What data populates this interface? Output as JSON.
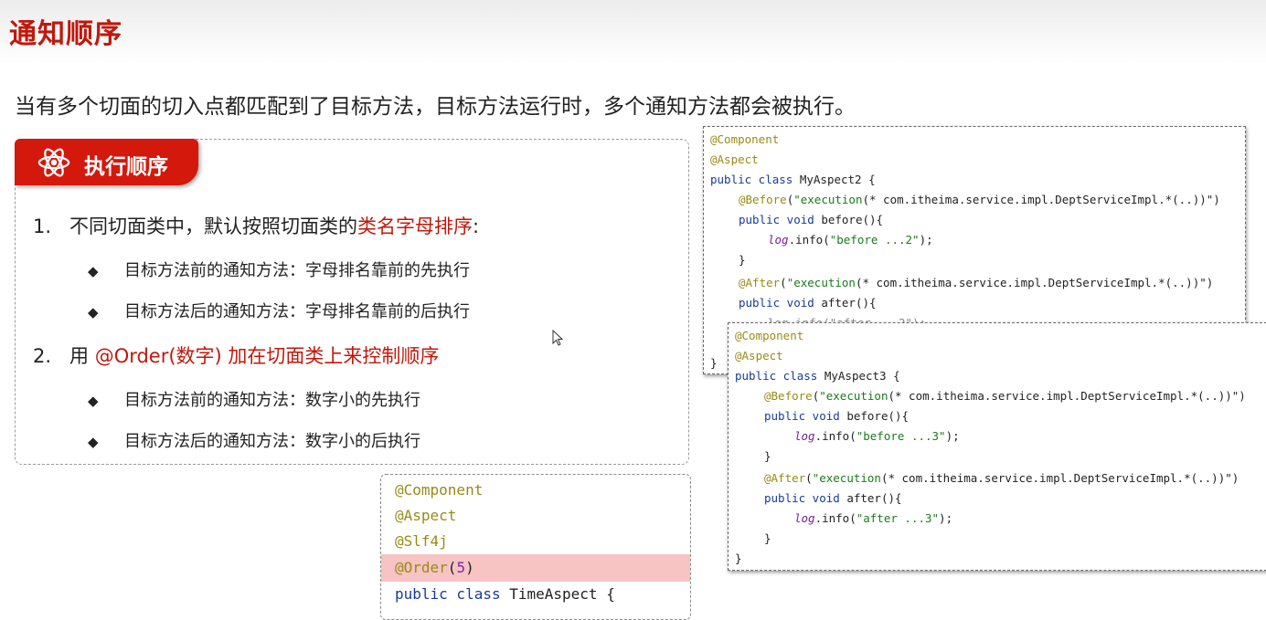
{
  "page": {
    "title": "通知顺序",
    "subtitle": "当有多个切面的切入点都匹配到了目标方法，目标方法运行时，多个通知方法都会被执行。"
  },
  "box": {
    "tag": {
      "icon": "atom-icon",
      "label": "执行顺序"
    },
    "item1": {
      "num": "1.",
      "prefix": "不同切面类中，默认按照切面类的",
      "highlight": "类名字母排序",
      "suffix": ":"
    },
    "item1_bullets": [
      "目标方法前的通知方法：字母排名靠前的先执行",
      "目标方法后的通知方法：字母排名靠前的后执行"
    ],
    "item2": {
      "num": "2.",
      "prefix": "用 ",
      "highlight": "@Order(数字) 加在切面类上来控制顺序"
    },
    "item2_bullets": [
      "目标方法前的通知方法：数字小的先执行",
      "目标方法后的通知方法：数字小的后执行"
    ],
    "bullet_char": "◆"
  },
  "code1": {
    "a1": "@Component",
    "a2": "@Aspect",
    "class_kw": "public class ",
    "class_name": "MyAspect2 {",
    "before_ann": "@Before",
    "before_open": "(",
    "before_str": "\"execution",
    "before_rest": "(* com.itheima.service.impl.DeptServiceImpl.*(..))\")",
    "before_sig_kw": "public void ",
    "before_sig": "before(){",
    "log1_a": "log",
    "log1_b": ".info(",
    "log1_str": "\"before ...2\"",
    "log1_c": ");",
    "close1": "}",
    "after_ann": "@After",
    "after_open": "(",
    "after_str": "\"execution",
    "after_rest": "(* com.itheima.service.impl.DeptServiceImpl.*(..))\")",
    "after_sig_kw": "public void ",
    "after_sig": "after(){",
    "partial": "log.info(\"after ...2\");",
    "close_last": "}"
  },
  "code2": {
    "a1": "@Component",
    "a2": "@Aspect",
    "class_kw": "public class ",
    "class_name": "MyAspect3 {",
    "before_ann": "@Before",
    "before_open": "(",
    "before_str": "\"execution",
    "before_rest": "(* com.itheima.service.impl.DeptServiceImpl.*(..))\")",
    "before_sig_kw": "public void ",
    "before_sig": "before(){",
    "log1_a": "log",
    "log1_b": ".info(",
    "log1_str": "\"before ...3\"",
    "log1_c": ");",
    "close1": "}",
    "after_ann": "@After",
    "after_open": "(",
    "after_str": "\"execution",
    "after_rest": "(* com.itheima.service.impl.DeptServiceImpl.*(..))\")",
    "after_sig_kw": "public void ",
    "after_sig": "after(){",
    "log2_a": "log",
    "log2_b": ".info(",
    "log2_str": "\"after ...3\"",
    "log2_c": ");",
    "close2": "}",
    "close_last": "}"
  },
  "code3": {
    "a1": "@Component",
    "a2": "@Aspect",
    "a3": "@Slf4j",
    "order_ann": "@Order",
    "order_open": "(",
    "order_num": "5",
    "order_close": ")",
    "class_kw": "public class ",
    "class_name": "TimeAspect {"
  },
  "colors": {
    "accent": "#c0180c",
    "tag_bg": "#d4180c",
    "highlight_row": "#f7c3c3",
    "annotation": "#9a8a15",
    "keyword": "#1a3a99",
    "string": "#1b7a1b"
  }
}
